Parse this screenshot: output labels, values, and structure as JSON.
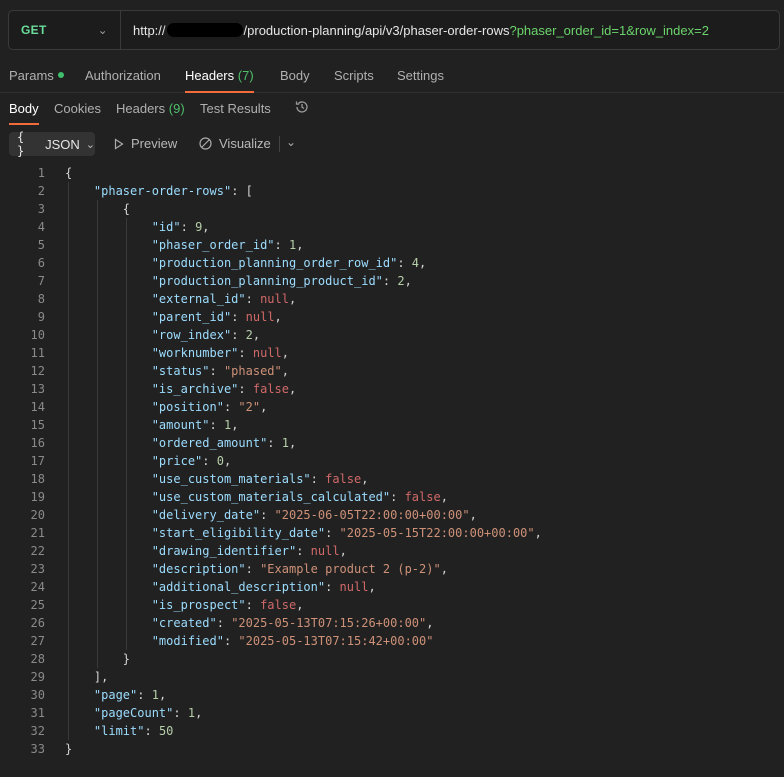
{
  "request": {
    "method": "GET",
    "url_prefix": "http://",
    "url_path": "/production-planning/api/v3/phaser-order-rows",
    "url_query": "?phaser_order_id=1&row_index=2"
  },
  "request_tabs": {
    "params": "Params",
    "authorization": "Authorization",
    "headers": "Headers",
    "headers_count": "(7)",
    "body": "Body",
    "scripts": "Scripts",
    "settings": "Settings"
  },
  "response_tabs": {
    "body": "Body",
    "cookies": "Cookies",
    "headers": "Headers",
    "headers_count": "(9)",
    "test_results": "Test Results"
  },
  "toolbar": {
    "format": "JSON",
    "preview": "Preview",
    "visualize": "Visualize"
  },
  "json_lines": [
    {
      "n": "1",
      "indent": 0,
      "tokens": [
        [
          "p",
          "{"
        ]
      ]
    },
    {
      "n": "2",
      "indent": 1,
      "tokens": [
        [
          "k",
          "\"phaser-order-rows\""
        ],
        [
          "p",
          ": ["
        ]
      ]
    },
    {
      "n": "3",
      "indent": 2,
      "tokens": [
        [
          "p",
          "{"
        ]
      ]
    },
    {
      "n": "4",
      "indent": 3,
      "tokens": [
        [
          "k",
          "\"id\""
        ],
        [
          "p",
          ": "
        ],
        [
          "n",
          "9"
        ],
        [
          "p",
          ","
        ]
      ]
    },
    {
      "n": "5",
      "indent": 3,
      "tokens": [
        [
          "k",
          "\"phaser_order_id\""
        ],
        [
          "p",
          ": "
        ],
        [
          "n",
          "1"
        ],
        [
          "p",
          ","
        ]
      ]
    },
    {
      "n": "6",
      "indent": 3,
      "tokens": [
        [
          "k",
          "\"production_planning_order_row_id\""
        ],
        [
          "p",
          ": "
        ],
        [
          "n",
          "4"
        ],
        [
          "p",
          ","
        ]
      ]
    },
    {
      "n": "7",
      "indent": 3,
      "tokens": [
        [
          "k",
          "\"production_planning_product_id\""
        ],
        [
          "p",
          ": "
        ],
        [
          "n",
          "2"
        ],
        [
          "p",
          ","
        ]
      ]
    },
    {
      "n": "8",
      "indent": 3,
      "tokens": [
        [
          "k",
          "\"external_id\""
        ],
        [
          "p",
          ": "
        ],
        [
          "l",
          "null"
        ],
        [
          "p",
          ","
        ]
      ]
    },
    {
      "n": "9",
      "indent": 3,
      "tokens": [
        [
          "k",
          "\"parent_id\""
        ],
        [
          "p",
          ": "
        ],
        [
          "l",
          "null"
        ],
        [
          "p",
          ","
        ]
      ]
    },
    {
      "n": "10",
      "indent": 3,
      "tokens": [
        [
          "k",
          "\"row_index\""
        ],
        [
          "p",
          ": "
        ],
        [
          "n",
          "2"
        ],
        [
          "p",
          ","
        ]
      ]
    },
    {
      "n": "11",
      "indent": 3,
      "tokens": [
        [
          "k",
          "\"worknumber\""
        ],
        [
          "p",
          ": "
        ],
        [
          "l",
          "null"
        ],
        [
          "p",
          ","
        ]
      ]
    },
    {
      "n": "12",
      "indent": 3,
      "tokens": [
        [
          "k",
          "\"status\""
        ],
        [
          "p",
          ": "
        ],
        [
          "s",
          "\"phased\""
        ],
        [
          "p",
          ","
        ]
      ]
    },
    {
      "n": "13",
      "indent": 3,
      "tokens": [
        [
          "k",
          "\"is_archive\""
        ],
        [
          "p",
          ": "
        ],
        [
          "l",
          "false"
        ],
        [
          "p",
          ","
        ]
      ]
    },
    {
      "n": "14",
      "indent": 3,
      "tokens": [
        [
          "k",
          "\"position\""
        ],
        [
          "p",
          ": "
        ],
        [
          "s",
          "\"2\""
        ],
        [
          "p",
          ","
        ]
      ]
    },
    {
      "n": "15",
      "indent": 3,
      "tokens": [
        [
          "k",
          "\"amount\""
        ],
        [
          "p",
          ": "
        ],
        [
          "n",
          "1"
        ],
        [
          "p",
          ","
        ]
      ]
    },
    {
      "n": "16",
      "indent": 3,
      "tokens": [
        [
          "k",
          "\"ordered_amount\""
        ],
        [
          "p",
          ": "
        ],
        [
          "n",
          "1"
        ],
        [
          "p",
          ","
        ]
      ]
    },
    {
      "n": "17",
      "indent": 3,
      "tokens": [
        [
          "k",
          "\"price\""
        ],
        [
          "p",
          ": "
        ],
        [
          "n",
          "0"
        ],
        [
          "p",
          ","
        ]
      ]
    },
    {
      "n": "18",
      "indent": 3,
      "tokens": [
        [
          "k",
          "\"use_custom_materials\""
        ],
        [
          "p",
          ": "
        ],
        [
          "l",
          "false"
        ],
        [
          "p",
          ","
        ]
      ]
    },
    {
      "n": "19",
      "indent": 3,
      "tokens": [
        [
          "k",
          "\"use_custom_materials_calculated\""
        ],
        [
          "p",
          ": "
        ],
        [
          "l",
          "false"
        ],
        [
          "p",
          ","
        ]
      ]
    },
    {
      "n": "20",
      "indent": 3,
      "tokens": [
        [
          "k",
          "\"delivery_date\""
        ],
        [
          "p",
          ": "
        ],
        [
          "s",
          "\"2025-06-05T22:00:00+00:00\""
        ],
        [
          "p",
          ","
        ]
      ]
    },
    {
      "n": "21",
      "indent": 3,
      "tokens": [
        [
          "k",
          "\"start_eligibility_date\""
        ],
        [
          "p",
          ": "
        ],
        [
          "s",
          "\"2025-05-15T22:00:00+00:00\""
        ],
        [
          "p",
          ","
        ]
      ]
    },
    {
      "n": "22",
      "indent": 3,
      "tokens": [
        [
          "k",
          "\"drawing_identifier\""
        ],
        [
          "p",
          ": "
        ],
        [
          "l",
          "null"
        ],
        [
          "p",
          ","
        ]
      ]
    },
    {
      "n": "23",
      "indent": 3,
      "tokens": [
        [
          "k",
          "\"description\""
        ],
        [
          "p",
          ": "
        ],
        [
          "s",
          "\"Example product 2 (p-2)\""
        ],
        [
          "p",
          ","
        ]
      ]
    },
    {
      "n": "24",
      "indent": 3,
      "tokens": [
        [
          "k",
          "\"additional_description\""
        ],
        [
          "p",
          ": "
        ],
        [
          "l",
          "null"
        ],
        [
          "p",
          ","
        ]
      ]
    },
    {
      "n": "25",
      "indent": 3,
      "tokens": [
        [
          "k",
          "\"is_prospect\""
        ],
        [
          "p",
          ": "
        ],
        [
          "l",
          "false"
        ],
        [
          "p",
          ","
        ]
      ]
    },
    {
      "n": "26",
      "indent": 3,
      "tokens": [
        [
          "k",
          "\"created\""
        ],
        [
          "p",
          ": "
        ],
        [
          "s",
          "\"2025-05-13T07:15:26+00:00\""
        ],
        [
          "p",
          ","
        ]
      ]
    },
    {
      "n": "27",
      "indent": 3,
      "tokens": [
        [
          "k",
          "\"modified\""
        ],
        [
          "p",
          ": "
        ],
        [
          "s",
          "\"2025-05-13T07:15:42+00:00\""
        ]
      ]
    },
    {
      "n": "28",
      "indent": 2,
      "tokens": [
        [
          "p",
          "}"
        ]
      ]
    },
    {
      "n": "29",
      "indent": 1,
      "tokens": [
        [
          "p",
          "],"
        ]
      ]
    },
    {
      "n": "30",
      "indent": 1,
      "tokens": [
        [
          "k",
          "\"page\""
        ],
        [
          "p",
          ": "
        ],
        [
          "n",
          "1"
        ],
        [
          "p",
          ","
        ]
      ]
    },
    {
      "n": "31",
      "indent": 1,
      "tokens": [
        [
          "k",
          "\"pageCount\""
        ],
        [
          "p",
          ": "
        ],
        [
          "n",
          "1"
        ],
        [
          "p",
          ","
        ]
      ]
    },
    {
      "n": "32",
      "indent": 1,
      "tokens": [
        [
          "k",
          "\"limit\""
        ],
        [
          "p",
          ": "
        ],
        [
          "n",
          "50"
        ]
      ]
    },
    {
      "n": "33",
      "indent": 0,
      "tokens": [
        [
          "p",
          "}"
        ]
      ]
    }
  ]
}
